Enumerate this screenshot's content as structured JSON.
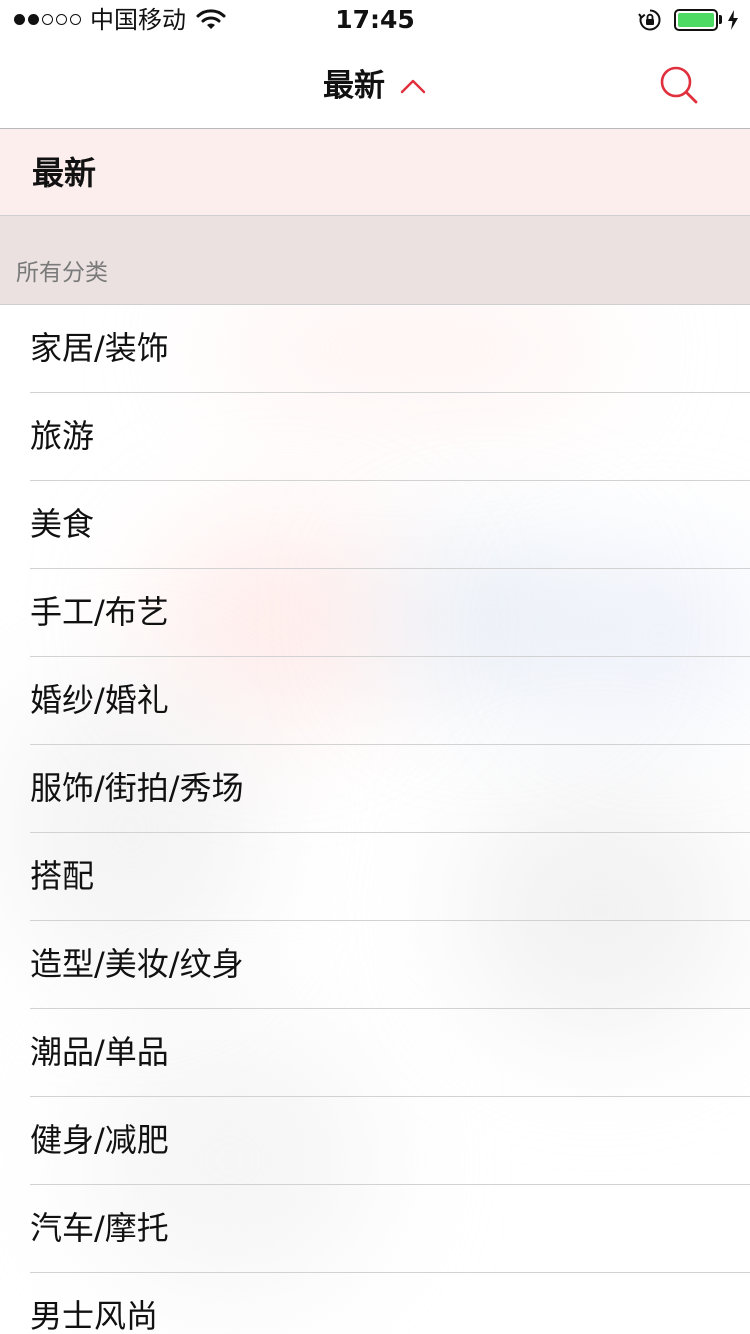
{
  "status_bar": {
    "carrier": "中国移动",
    "time": "17:45",
    "signal_dots_filled": 2,
    "signal_dots_total": 5,
    "battery_level": 1.0
  },
  "nav": {
    "title": "最新",
    "icons": {
      "dropdown": "chevron-up-icon",
      "search": "search-icon"
    }
  },
  "selected": {
    "label": "最新"
  },
  "section": {
    "label": "所有分类"
  },
  "categories": [
    "家居/装饰",
    "旅游",
    "美食",
    "手工/布艺",
    "婚纱/婚礼",
    "服饰/街拍/秀场",
    "搭配",
    "造型/美妆/纹身",
    "潮品/单品",
    "健身/减肥",
    "汽车/摩托",
    "男士风尚"
  ],
  "colors": {
    "accent": "#e0303e",
    "selected_bg": "#fdeeee",
    "section_bg": "#ebe1e1",
    "battery": "#4cd964"
  }
}
